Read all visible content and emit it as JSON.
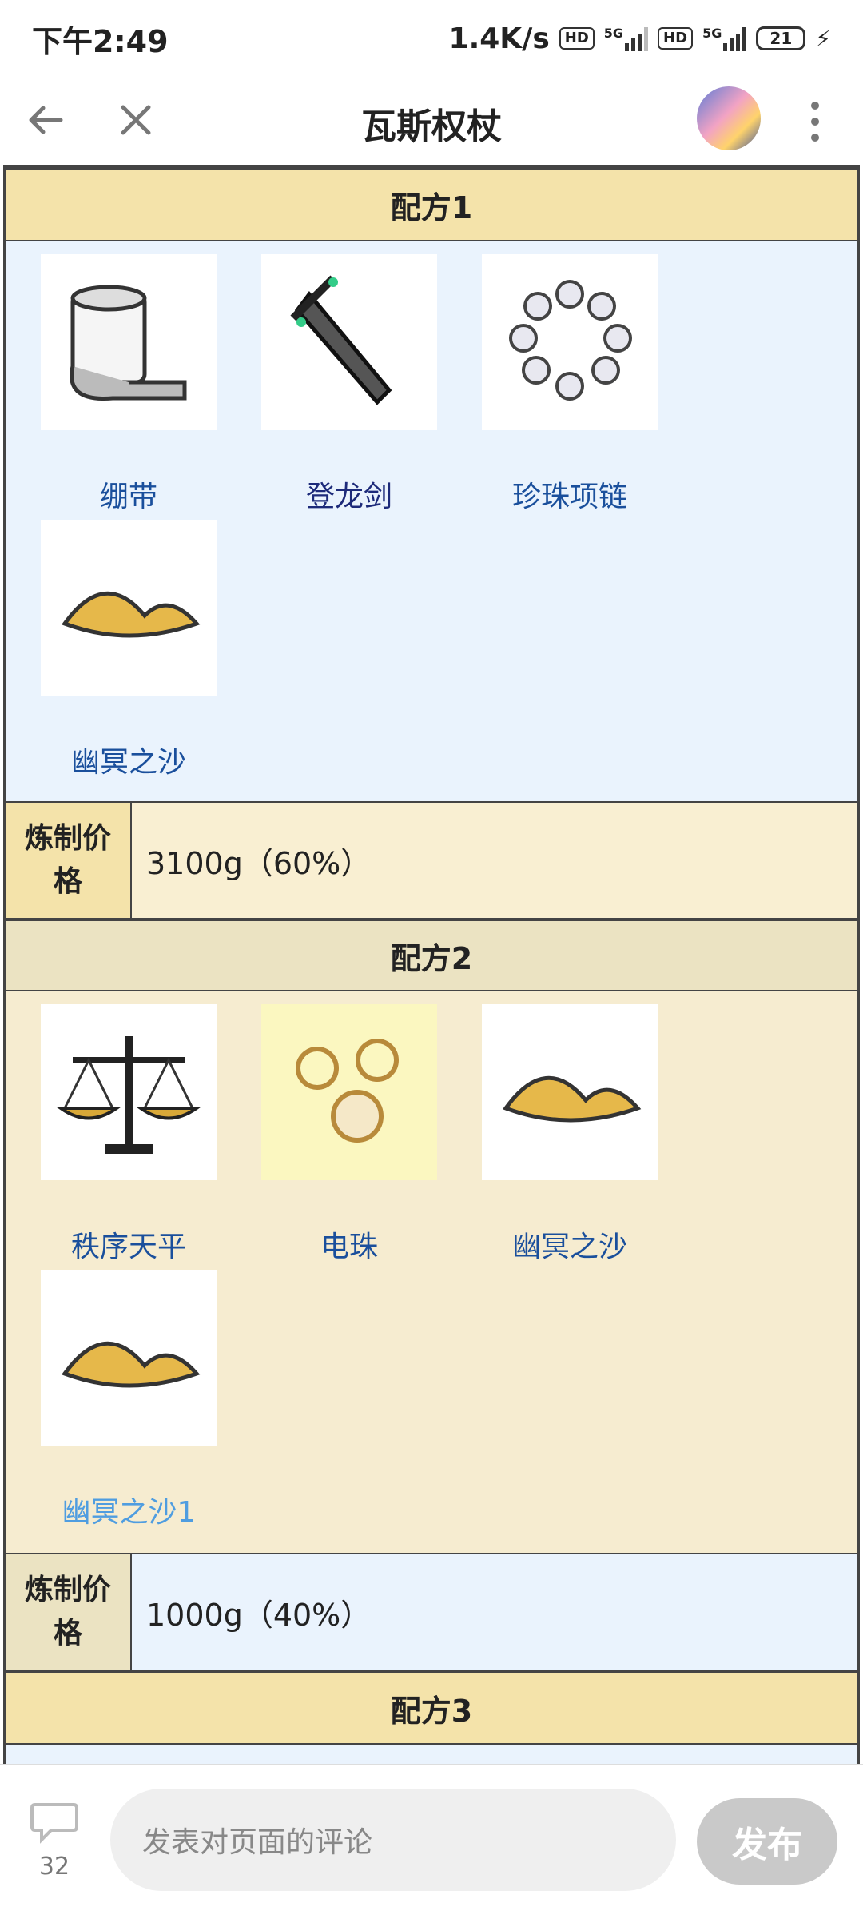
{
  "status_bar": {
    "time": "下午2:49",
    "speed": "1.4K/s",
    "hd_badge": "HD",
    "net_label": "5G",
    "battery": "21"
  },
  "app_bar": {
    "title": "瓦斯权杖"
  },
  "recipes": [
    {
      "header": "配方1",
      "items": [
        "绷带",
        "登龙剑",
        "珍珠项链",
        "幽冥之沙"
      ],
      "price_label": "炼制价格",
      "price_value": "3100g（60%）"
    },
    {
      "header": "配方2",
      "items": [
        "秩序天平",
        "电珠",
        "幽冥之沙",
        "幽冥之沙1"
      ],
      "price_label": "炼制价格",
      "price_value": "1000g（40%）"
    },
    {
      "header": "配方3"
    }
  ],
  "bottom_bar": {
    "comment_count": "32",
    "placeholder": "发表对页面的评论",
    "send_label": "发布"
  },
  "colors": {
    "header_gold": "#f4e3aa",
    "section_blue": "#eaf3fd",
    "section_cream": "#f6ecd0",
    "price_cream": "#f9efd2",
    "link": "#1a4f9c"
  }
}
